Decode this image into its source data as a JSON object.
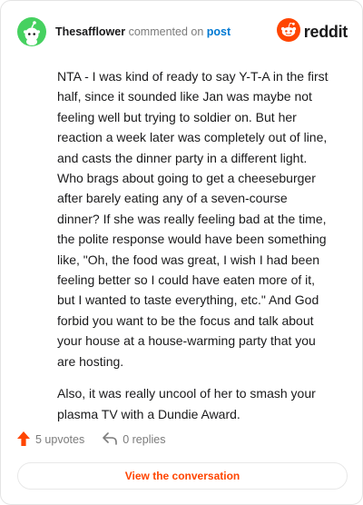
{
  "header": {
    "username": "Thesafflower",
    "action": "commented on",
    "target": "post",
    "brand": "reddit"
  },
  "comment": {
    "paragraphs": [
      "NTA - I was kind of ready to say Y-T-A in the first half, since it sounded like Jan was maybe not feeling well but trying to soldier on. But her reaction a week later was completely out of line, and casts the dinner party in a different light. Who brags about going to get a cheeseburger after barely eating any of a seven-course dinner? If she was really feeling bad at the time, the polite response would have been something like, \"Oh, the food was great, I wish I had been feeling better so I could have eaten more of it, but I wanted to taste everything, etc.\" And God forbid you want to be the focus and talk about your house at a house-warming party that you are hosting.",
      "Also, it was really uncool of her to smash your plasma TV with a Dundie Award."
    ]
  },
  "footer": {
    "upvotes": "5 upvotes",
    "replies": "0 replies"
  },
  "cta": {
    "label": "View the conversation"
  },
  "colors": {
    "accent": "#ff4500",
    "link": "#0079d3",
    "avatar": "#46d160"
  },
  "icons": {
    "avatar": "snoo-avatar-icon",
    "brand": "reddit-logo-icon",
    "upvote": "upvote-arrow-icon",
    "reply": "reply-arrow-icon"
  }
}
